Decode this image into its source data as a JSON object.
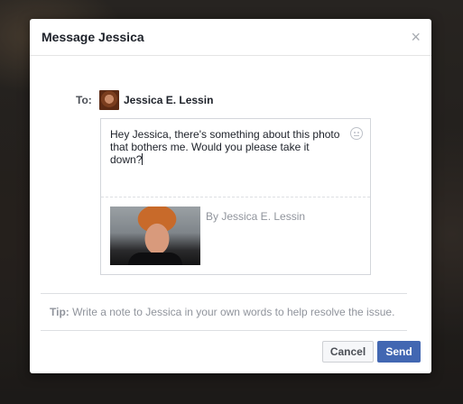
{
  "dialog": {
    "title": "Message Jessica",
    "close_symbol": "×"
  },
  "recipient": {
    "label": "To:",
    "name": "Jessica E. Lessin"
  },
  "message": {
    "text": "Hey Jessica, there's something about this photo\nthat bothers me. Would you please take it\ndown?"
  },
  "attachment": {
    "caption": "By Jessica E. Lessin"
  },
  "tip": {
    "label": "Tip:",
    "text": " Write a note to Jessica in your own words to help resolve the issue."
  },
  "buttons": {
    "cancel": "Cancel",
    "send": "Send"
  },
  "colors": {
    "accent": "#4267b2",
    "muted_text": "#90949c"
  },
  "icons": [
    "close-icon",
    "emoji-icon"
  ]
}
